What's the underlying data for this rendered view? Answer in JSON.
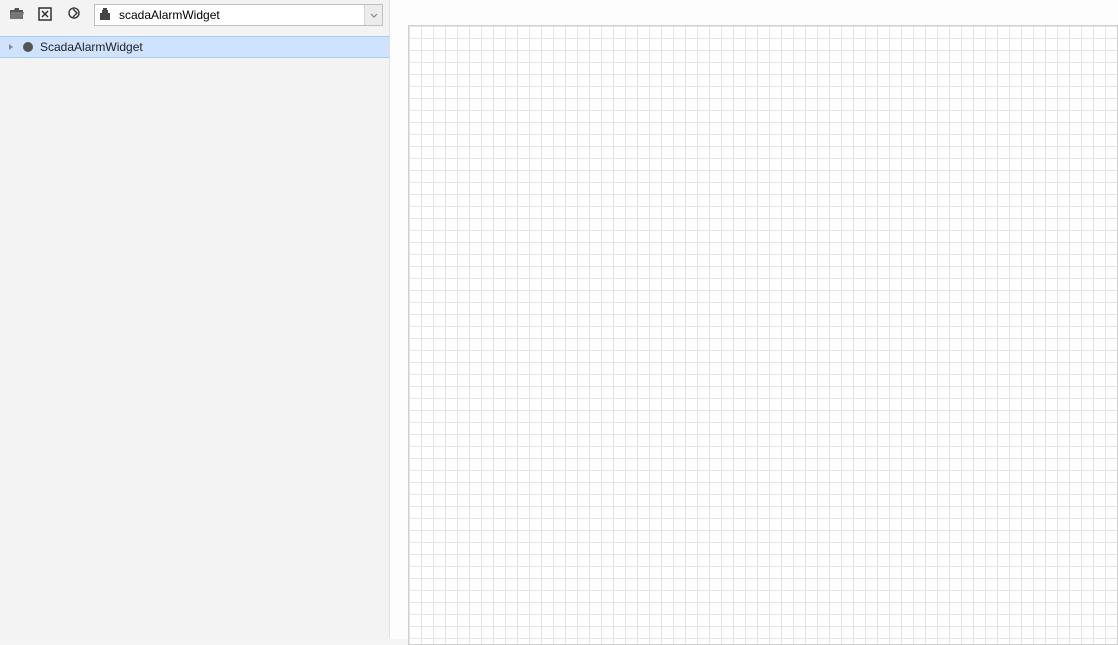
{
  "toolbar": {
    "open_icon": "folder-open-icon",
    "close_icon": "close-box-icon",
    "locate_icon": "locate-icon"
  },
  "combo": {
    "icon": "widget-icon",
    "value": "scadaAlarmWidget"
  },
  "tree": {
    "items": [
      {
        "label": "ScadaAlarmWidget",
        "selected": true
      }
    ]
  }
}
